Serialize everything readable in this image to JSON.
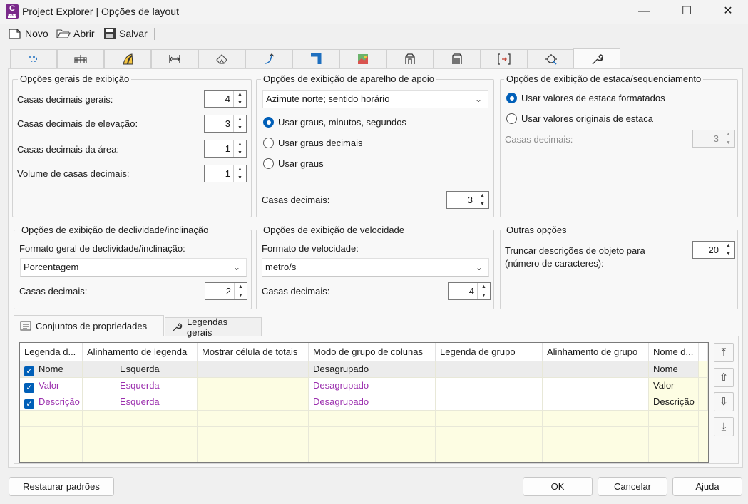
{
  "window": {
    "title": "Project Explorer | Opções de layout",
    "app_badge": "C",
    "app_badge_sub": "C3D",
    "minimize": "—",
    "maximize": "☐",
    "close": "✕"
  },
  "toolbar": {
    "new_label": "Novo",
    "open_label": "Abrir",
    "save_label": "Salvar"
  },
  "icon_tabs": [
    "alignment-icon",
    "bridge-icon",
    "road-icon",
    "corridor-icon",
    "surface-icon",
    "curve-icon",
    "pipe-icon",
    "map-icon",
    "structure-a-icon",
    "structure-b-icon",
    "offset-icon",
    "settings-target-icon",
    "wrench-icon"
  ],
  "general_display": {
    "title": "Opções gerais de exibição",
    "rows": [
      {
        "label": "Casas decimais gerais:",
        "value": "4"
      },
      {
        "label": "Casas decimais de elevação:",
        "value": "3"
      },
      {
        "label": "Casas decimais da área:",
        "value": "1"
      },
      {
        "label": "Volume de casas decimais:",
        "value": "1"
      }
    ]
  },
  "bearing_display": {
    "title": "Opções de exibição de aparelho de apoio",
    "combo_value": "Azimute norte; sentido horário",
    "radios": [
      {
        "label": "Usar graus, minutos, segundos",
        "checked": true
      },
      {
        "label": "Usar graus decimais",
        "checked": false
      },
      {
        "label": "Usar graus",
        "checked": false
      }
    ],
    "decimals_label": "Casas decimais:",
    "decimals_value": "3"
  },
  "station_display": {
    "title": "Opções de exibição de estaca/sequenciamento",
    "radios": [
      {
        "label": "Usar valores de estaca formatados",
        "checked": true
      },
      {
        "label": "Usar valores originais de estaca",
        "checked": false
      }
    ],
    "decimals_label": "Casas decimais:",
    "decimals_value": "3"
  },
  "slope_display": {
    "title": "Opções de exibição de declividade/inclinação",
    "format_label": "Formato geral de declividade/inclinação:",
    "combo_value": "Porcentagem",
    "decimals_label": "Casas decimais:",
    "decimals_value": "2"
  },
  "speed_display": {
    "title": "Opções de exibição de velocidade",
    "format_label": "Formato de velocidade:",
    "combo_value": "metro/s",
    "decimals_label": "Casas decimais:",
    "decimals_value": "4"
  },
  "other_options": {
    "title": "Outras opções",
    "truncate_label_1": "Truncar descrições de objeto para",
    "truncate_label_2": "(número de caracteres):",
    "truncate_value": "20"
  },
  "lower_tabs": {
    "property_sets": "Conjuntos de propriedades",
    "general_captions": "Legendas gerais"
  },
  "grid": {
    "headers": [
      "Legenda d...",
      "Alinhamento de legenda",
      "Mostrar célula de totais",
      "Modo de grupo de colunas",
      "Legenda de grupo",
      "Alinhamento de grupo",
      "Nome d..."
    ],
    "rows": [
      {
        "caption": "Nome",
        "alignment": "Esquerda",
        "totals": "",
        "group_mode": "Desagrupado",
        "group_caption": "",
        "group_alignment": "",
        "name": "Nome",
        "checked": true
      },
      {
        "caption": "Valor",
        "alignment": "Esquerda",
        "totals": "",
        "group_mode": "Desagrupado",
        "group_caption": "",
        "group_alignment": "",
        "name": "Valor",
        "checked": true
      },
      {
        "caption": "Descrição",
        "alignment": "Esquerda",
        "totals": "",
        "group_mode": "Desagrupado",
        "group_caption": "",
        "group_alignment": "",
        "name": "Descrição",
        "checked": true
      }
    ]
  },
  "buttons": {
    "restore": "Restaurar padrões",
    "ok": "OK",
    "cancel": "Cancelar",
    "help": "Ajuda"
  },
  "colors": {
    "accent": "#005fb8",
    "link_purple": "#9b2fae",
    "row_yellow": "#fdfde3",
    "row_selected": "#ececec"
  }
}
